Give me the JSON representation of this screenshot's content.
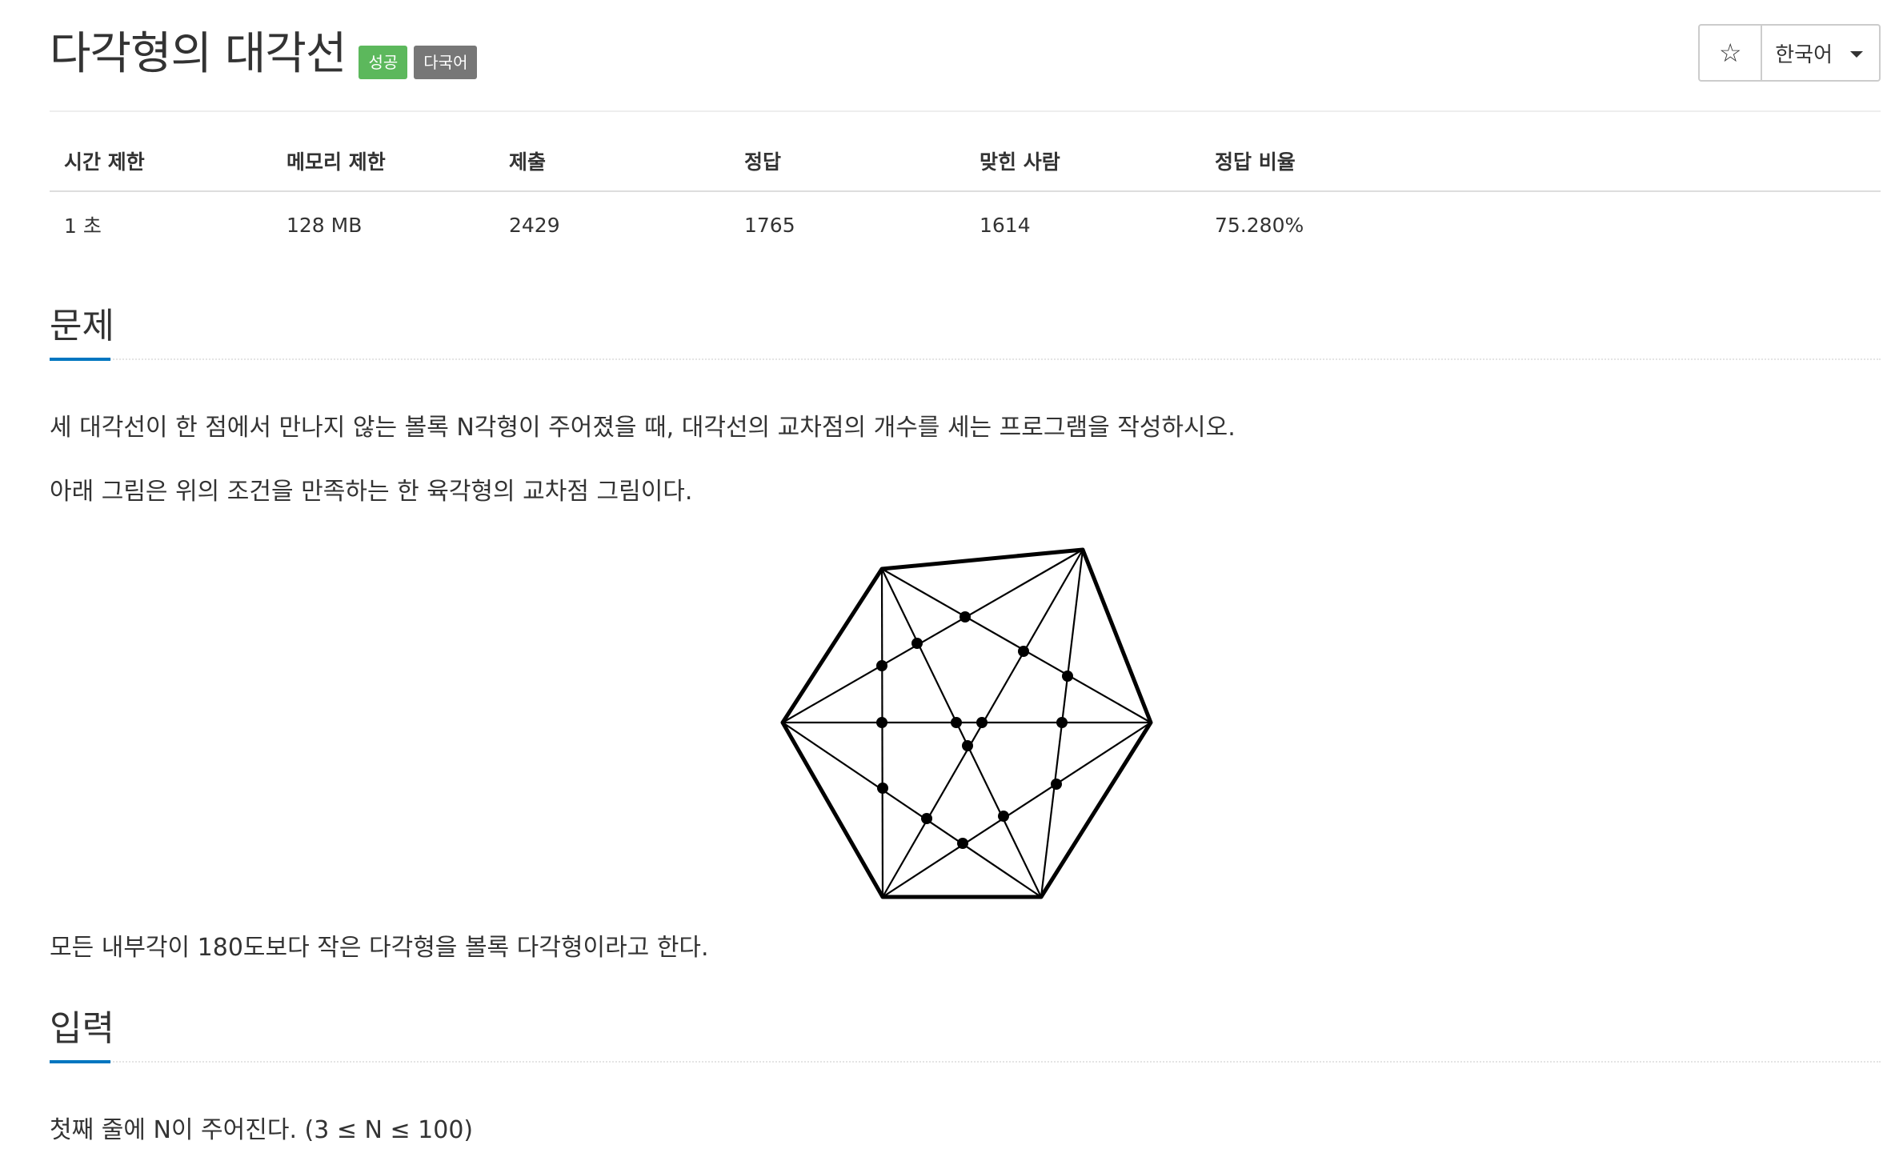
{
  "problem": {
    "title": "다각형의 대각선",
    "labels": {
      "success": "성공",
      "multilang": "다국어"
    }
  },
  "toolbar": {
    "star_icon": "star-icon",
    "star_glyph": "☆",
    "language_label": "한국어"
  },
  "info_table": {
    "headers": [
      "시간 제한",
      "메모리 제한",
      "제출",
      "정답",
      "맞힌 사람",
      "정답 비율"
    ],
    "values": [
      "1 초",
      "128 MB",
      "2429",
      "1765",
      "1614",
      "75.280%"
    ]
  },
  "sections": {
    "problem": {
      "heading": "문제",
      "paragraph_1": "세 대각선이 한 점에서 만나지 않는 볼록 N각형이 주어졌을 때, 대각선의 교차점의 개수를 세는 프로그램을 작성하시오.",
      "paragraph_2": "아래 그림은 위의 조건을 만족하는 한 육각형의 교차점 그림이다.",
      "paragraph_3": "모든 내부각이 180도보다 작은 다각형을 볼록 다각형이라고 한다."
    },
    "input": {
      "heading": "입력",
      "paragraph_1": "첫째 줄에 N이 주어진다. (3 ≤ N ≤ 100)"
    }
  },
  "colors": {
    "success_label": "#5cb85c",
    "default_label": "#777777",
    "section_underline": "#0076c0"
  }
}
